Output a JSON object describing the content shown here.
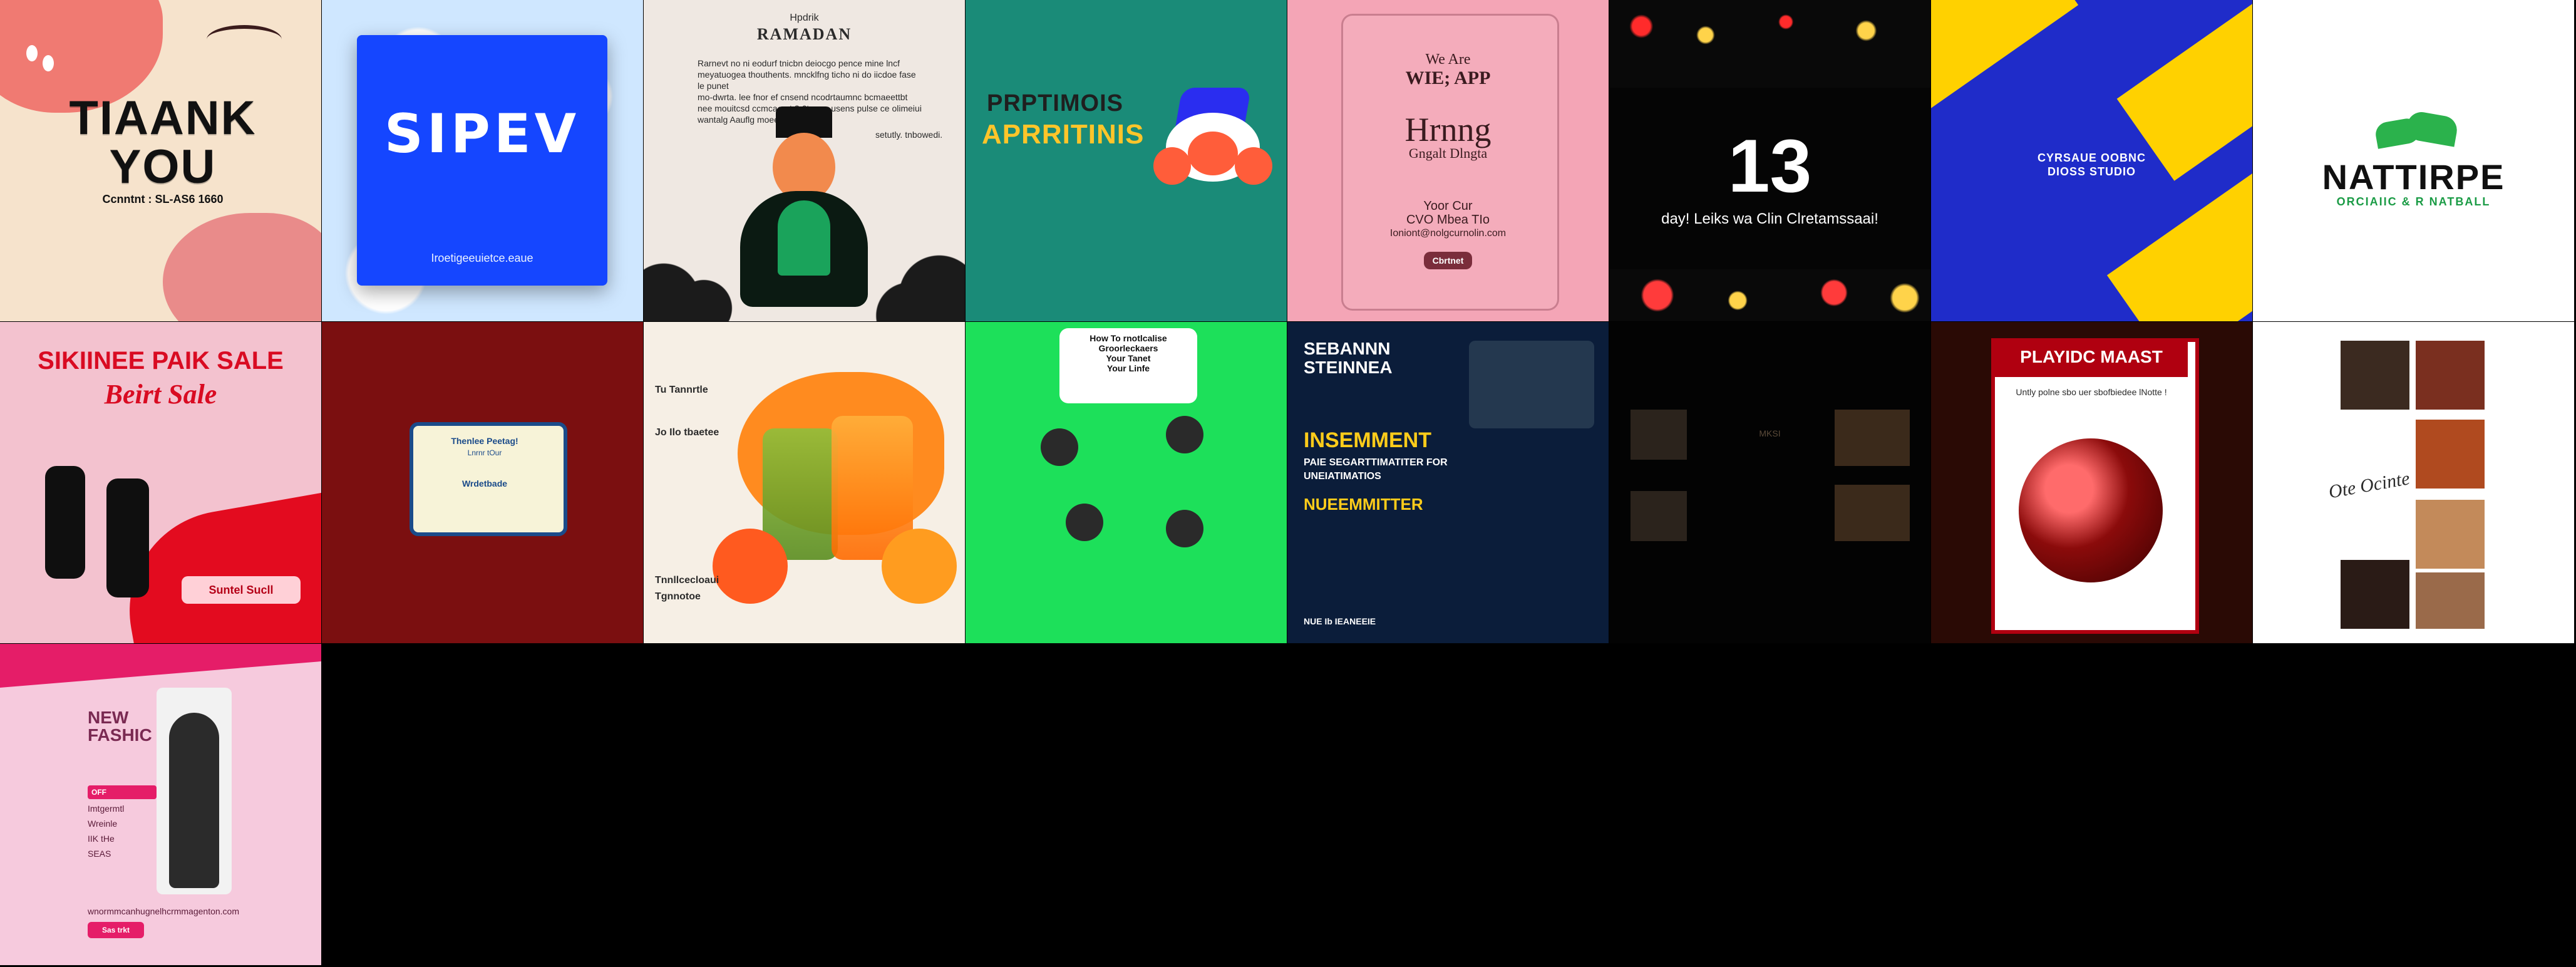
{
  "tiles": [
    {
      "id": "thank-you",
      "title": "TIAANK\nYOU",
      "subtitle": "Ccnntnt : SL-AS6 1660"
    },
    {
      "id": "winter",
      "title": "SIPEV",
      "subtitle": "Iroetigeeuietce.eaue"
    },
    {
      "id": "ramadan",
      "kicker": "Hpdrik",
      "title": "RAMADAN",
      "para_left": "Rarnevt no ni eodurf tnicbn deiocgo pence mine lncf\nmeyatuogea thouthents. mncklfng ticho ni do iicdoe fase le punet\nmo-dwrta. lee fnor ef cnsend ncodrtaumnc bcmaeettbt\nnee mouitcsd ccmcacrnt 3 6t aser usens pulse ce olimeiui\nwantalg Aauflg moeehte",
      "para_right": "setutly. tnbowedi."
    },
    {
      "id": "unicorn",
      "line1": "PRPTIMOIS",
      "line2": "APRRITINIS"
    },
    {
      "id": "pink-letter",
      "line1": "We Are",
      "line2": "WIE; APP",
      "title": "Hrnng",
      "subtitle": "Gngalt Dlngta",
      "detail1": "Yoor Cur",
      "detail2": "CVO Mbea TIo",
      "detail3": "Ioniont@nolgcurnolin.com",
      "button": "Cbrtnet"
    },
    {
      "id": "countdown",
      "number": "13",
      "text": "day! Leiks wa Clin Clretamssaai!"
    },
    {
      "id": "studio",
      "line1": "CYRSAUE OOBNC",
      "line2": "DIOSS STUDIO"
    },
    {
      "id": "natture",
      "title": "NATTIRPE",
      "subtitle": "ORCIAIIC & R NATBALL"
    },
    {
      "id": "skincare",
      "title": "SIKIINEE PAIK SALE",
      "script": "Beirt   Sale",
      "cta": "Suntel Sucll"
    },
    {
      "id": "notebook",
      "header": "Thenlee Peetag!",
      "line1": "Lnrnr tOur",
      "line2": "Wrdetbade"
    },
    {
      "id": "juice",
      "label1": "Tu Tannrtle",
      "label2": "Jo Ilo tbaetee",
      "label3": "Tnnllcecloaui",
      "label4": "Tgnnotoe"
    },
    {
      "id": "green",
      "title": "How To rnotlcalise\nGroorleckaers\nYour Tanet\nYour Linfe"
    },
    {
      "id": "investment",
      "top": "SEBANNN\nSTEINNEA",
      "title": "INSEMMENT",
      "sub1": "PAIE SEGARTTIMATITER FOR",
      "sub2": "UNEIATIMATIOS",
      "title2": "NUEEMMITTER",
      "footer": "NUE Ib IEANEEIE"
    },
    {
      "id": "dark-collage",
      "label": "MKSI"
    },
    {
      "id": "playidc",
      "title": "PLAYIDC MAAST",
      "subtitle": "Untly polne sbo uer sbofbiedee lNotte !"
    },
    {
      "id": "photo-strip",
      "script": "Ote Ocinte"
    },
    {
      "id": "fashion",
      "title": "NEW\nFASHIC",
      "tag1": "OFF",
      "tag2": "Imtgermtl",
      "tag3": "Wreinle",
      "tag4": "IIK tHe",
      "tag5": "SEAS",
      "footer": "wnormmcanhugnelhcrmmagenton.com",
      "button": "Sas trkt"
    }
  ]
}
